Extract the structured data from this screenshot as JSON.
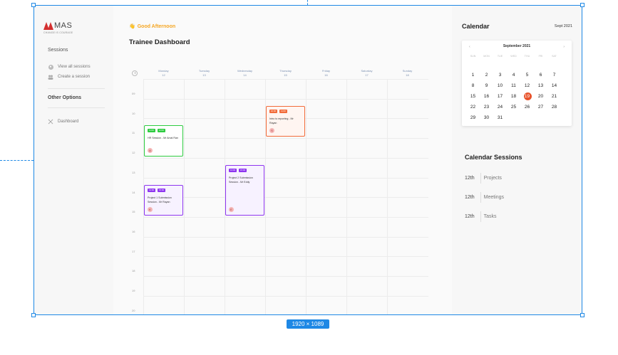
{
  "canvas": {
    "size_badge": "1920 × 1089"
  },
  "sidebar": {
    "logo_text": "MAS",
    "logo_tagline": "CHANGE IS COURAGE",
    "sessions_heading": "Sessions",
    "items": [
      {
        "label": "View all sessions",
        "icon": "circle-icon"
      },
      {
        "label": "Create a session",
        "icon": "users-icon"
      }
    ],
    "other_heading": "Other Options",
    "other_items": [
      {
        "label": "Dashboard",
        "icon": "dashboard-icon"
      }
    ]
  },
  "main": {
    "greeting": "Good Afternoon",
    "greeting_icon": "👋",
    "title": "Trainee Dashboard",
    "days": [
      {
        "name": "Monday",
        "date": "12"
      },
      {
        "name": "Tuesday",
        "date": "13"
      },
      {
        "name": "Wednesday",
        "date": "14"
      },
      {
        "name": "Thursday",
        "date": "15"
      },
      {
        "name": "Friday",
        "date": "16"
      },
      {
        "name": "Saturday",
        "date": "17"
      },
      {
        "name": "Sunday",
        "date": "18"
      }
    ],
    "hours": [
      "09",
      "10",
      "11",
      "12",
      "13",
      "14",
      "15",
      "16",
      "17",
      "18",
      "19",
      "20"
    ],
    "events": [
      {
        "title": "HR Session - Mr Amal Ran",
        "start": "11:00",
        "end": "12:00",
        "avatar": "A",
        "color": "#2ecc40",
        "bg": "#ffffff",
        "border": "#2ecc40",
        "day": 0
      },
      {
        "title": "Intro to reporting - Mr Rayan",
        "start": "10:00",
        "end": "11:00",
        "avatar": "S",
        "color": "#f26b3a",
        "bg": "#fff5f1",
        "border": "#f26b3a",
        "day": 3
      },
      {
        "title": "Project 2 Submission Session - Mr Eddy",
        "start": "13:00",
        "end": "15:00",
        "avatar": "E",
        "color": "#8e35ef",
        "bg": "#f7f2ff",
        "border": "#8e35ef",
        "day": 2
      },
      {
        "title": "Project 1 Submission Session - Mr Rayan",
        "start": "14:00",
        "end": "15:00",
        "avatar": "K",
        "color": "#8e35ef",
        "bg": "#f7f2ff",
        "border": "#8e35ef",
        "day": 0
      }
    ]
  },
  "calendar": {
    "title": "Calendar",
    "current": "Sept 2021",
    "month_label": "September 2021",
    "prev": "‹",
    "next": "›",
    "dow": [
      "SUN",
      "MON",
      "TUE",
      "WED",
      "THU",
      "FRI",
      "SAT"
    ],
    "weeks": [
      [
        "1",
        "2",
        "3",
        "4",
        "5",
        "6",
        "7"
      ],
      [
        "8",
        "9",
        "10",
        "11",
        "12",
        "13",
        "14"
      ],
      [
        "15",
        "16",
        "17",
        "18",
        "19",
        "20",
        "21"
      ],
      [
        "22",
        "23",
        "24",
        "25",
        "26",
        "27",
        "28"
      ],
      [
        "29",
        "30",
        "31",
        "",
        "",
        "",
        ""
      ]
    ],
    "today": "19",
    "accent": "#e8532b"
  },
  "sessions": {
    "title": "Calendar Sessions",
    "items": [
      {
        "date": "12th",
        "name": "Projects"
      },
      {
        "date": "12th",
        "name": "Meetings"
      },
      {
        "date": "12th",
        "name": "Tasks"
      }
    ]
  }
}
